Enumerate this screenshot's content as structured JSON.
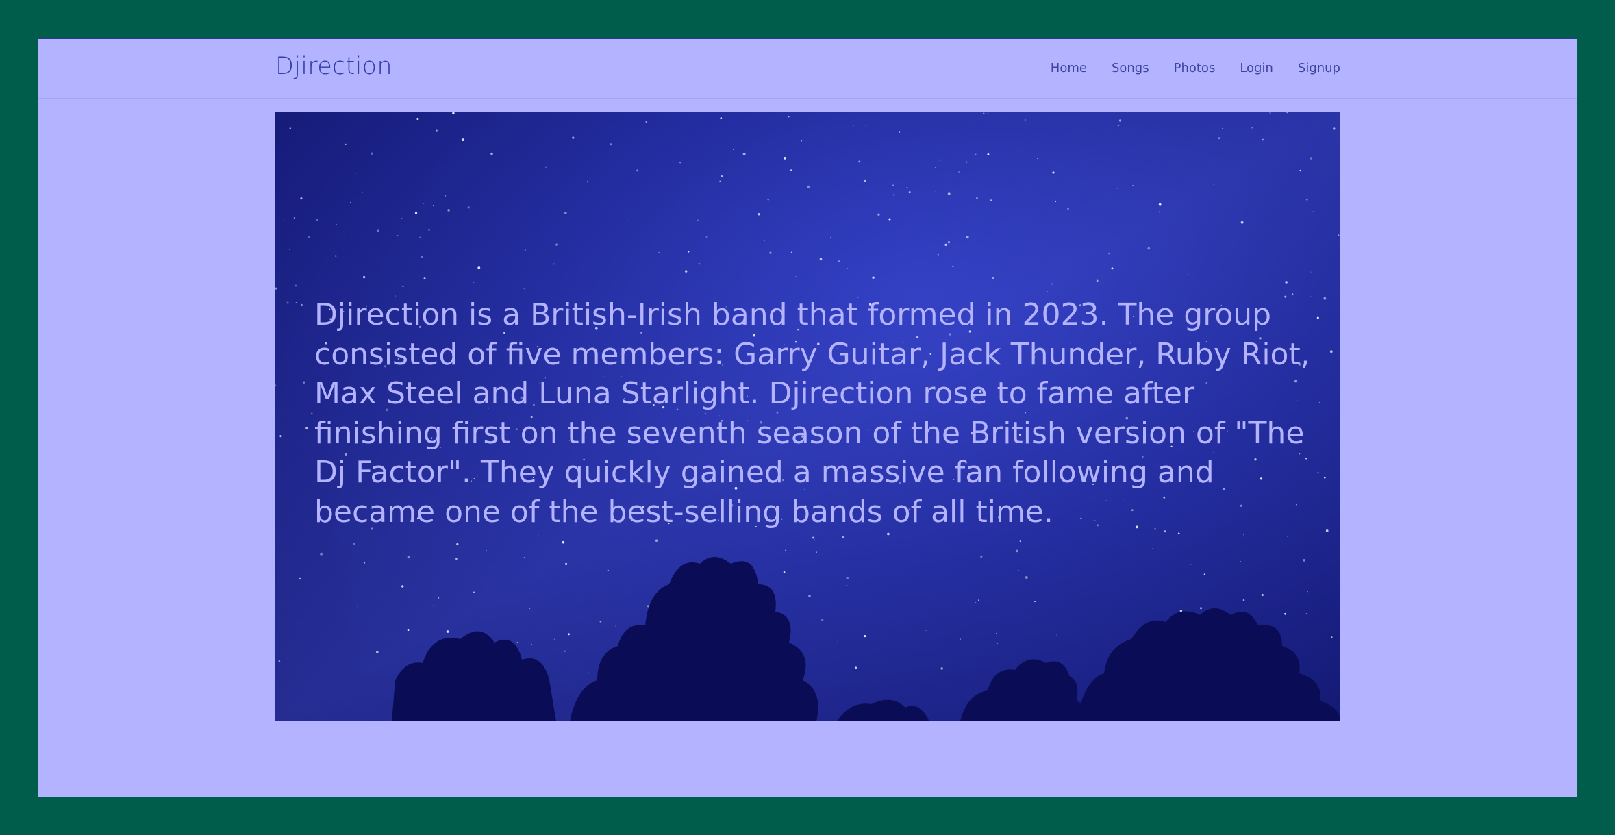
{
  "navbar": {
    "brand": "Djirection",
    "links": [
      {
        "label": "Home"
      },
      {
        "label": "Songs"
      },
      {
        "label": "Photos"
      },
      {
        "label": "Login"
      },
      {
        "label": "Signup"
      }
    ]
  },
  "hero": {
    "text": "Djirection is a British-Irish band that formed in 2023. The group consisted of five members: Garry Guitar, Jack Thunder, Ruby Riot, Max Steel and Luna Starlight. Djirection rose to fame after finishing first on the seventh season of the British version of \"The Dj Factor\". They quickly gained a massive fan following and became one of the best-selling bands of all time."
  },
  "colors": {
    "outer_background": "#005c4b",
    "page_background": "#b3b3ff",
    "brand": "#2f3fa8",
    "hero_text": "#b3b3ff"
  }
}
